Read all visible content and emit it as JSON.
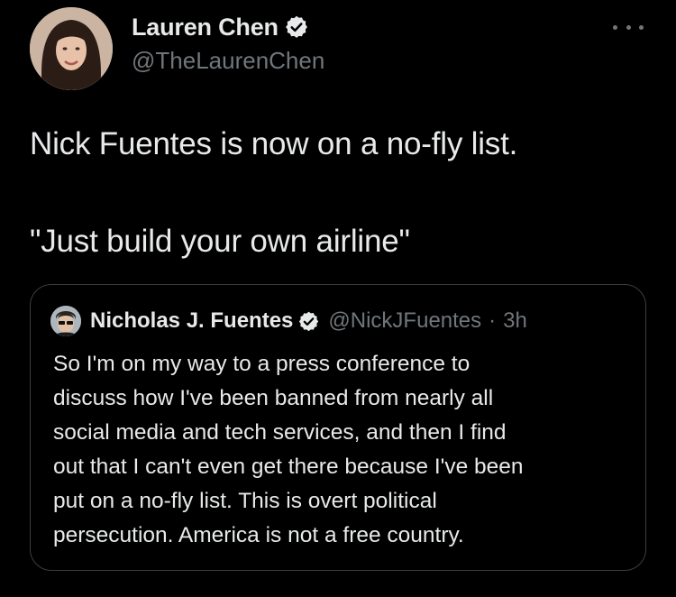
{
  "author": {
    "name": "Lauren Chen",
    "handle": "@TheLaurenChen"
  },
  "tweet": {
    "line1": "Nick Fuentes is now on a no-fly list.",
    "line2": "\"Just build your own airline\""
  },
  "quote": {
    "name": "Nicholas J. Fuentes",
    "handle": "@NickJFuentes",
    "separator": "·",
    "time": "3h",
    "lines": [
      "So I'm on my way to a press conference to",
      "discuss how I've been banned from nearly all",
      "social media and tech services, and then I find",
      "out that I can't even get there because I've been",
      "put on a no-fly list. This is overt political",
      "persecution. America is not a free country."
    ]
  },
  "icons": {
    "verified": "verified-badge-icon",
    "more": "more-horizontal-icon"
  },
  "colors": {
    "background": "#000000",
    "primary_text": "#e7e9ea",
    "secondary_text": "#71767b",
    "border": "#3a3d40"
  }
}
